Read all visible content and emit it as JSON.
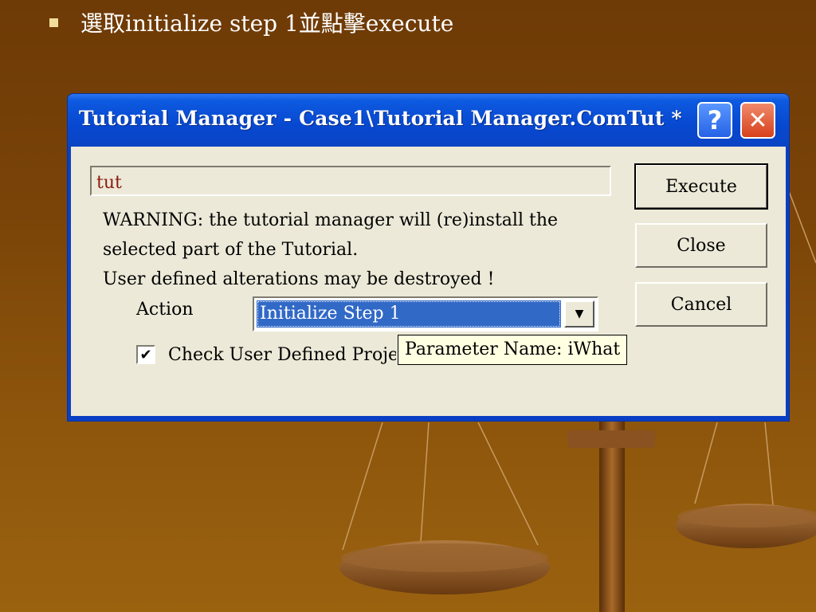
{
  "slide": {
    "bullet_text": "選取initialize step 1並點擊execute"
  },
  "window": {
    "title": "Tutorial Manager - Case1\\Tutorial Manager.ComTut *",
    "help_glyph": "?",
    "close_glyph": "✕"
  },
  "form": {
    "name_value": "tut",
    "warning_lines": [
      "WARNING: the tutorial manager will (re)install the",
      "selected part of the Tutorial.",
      "User defined alterations may be destroyed !"
    ],
    "action_label": "Action",
    "action_selected": "Initialize Step 1",
    "checkbox_label": "Check User Defined Projects",
    "checkbox_checked": true,
    "checkbox_mark": "✔",
    "tooltip": "Parameter Name: iWhat",
    "dropdown_arrow": "▼"
  },
  "buttons": {
    "execute": "Execute",
    "close": "Close",
    "cancel": "Cancel"
  },
  "colors": {
    "background": "#7a4408",
    "titlebar": "#0a44c4",
    "dialog_face": "#ece9d8",
    "selection": "#3169c6",
    "tooltip_bg": "#ffffe1"
  }
}
